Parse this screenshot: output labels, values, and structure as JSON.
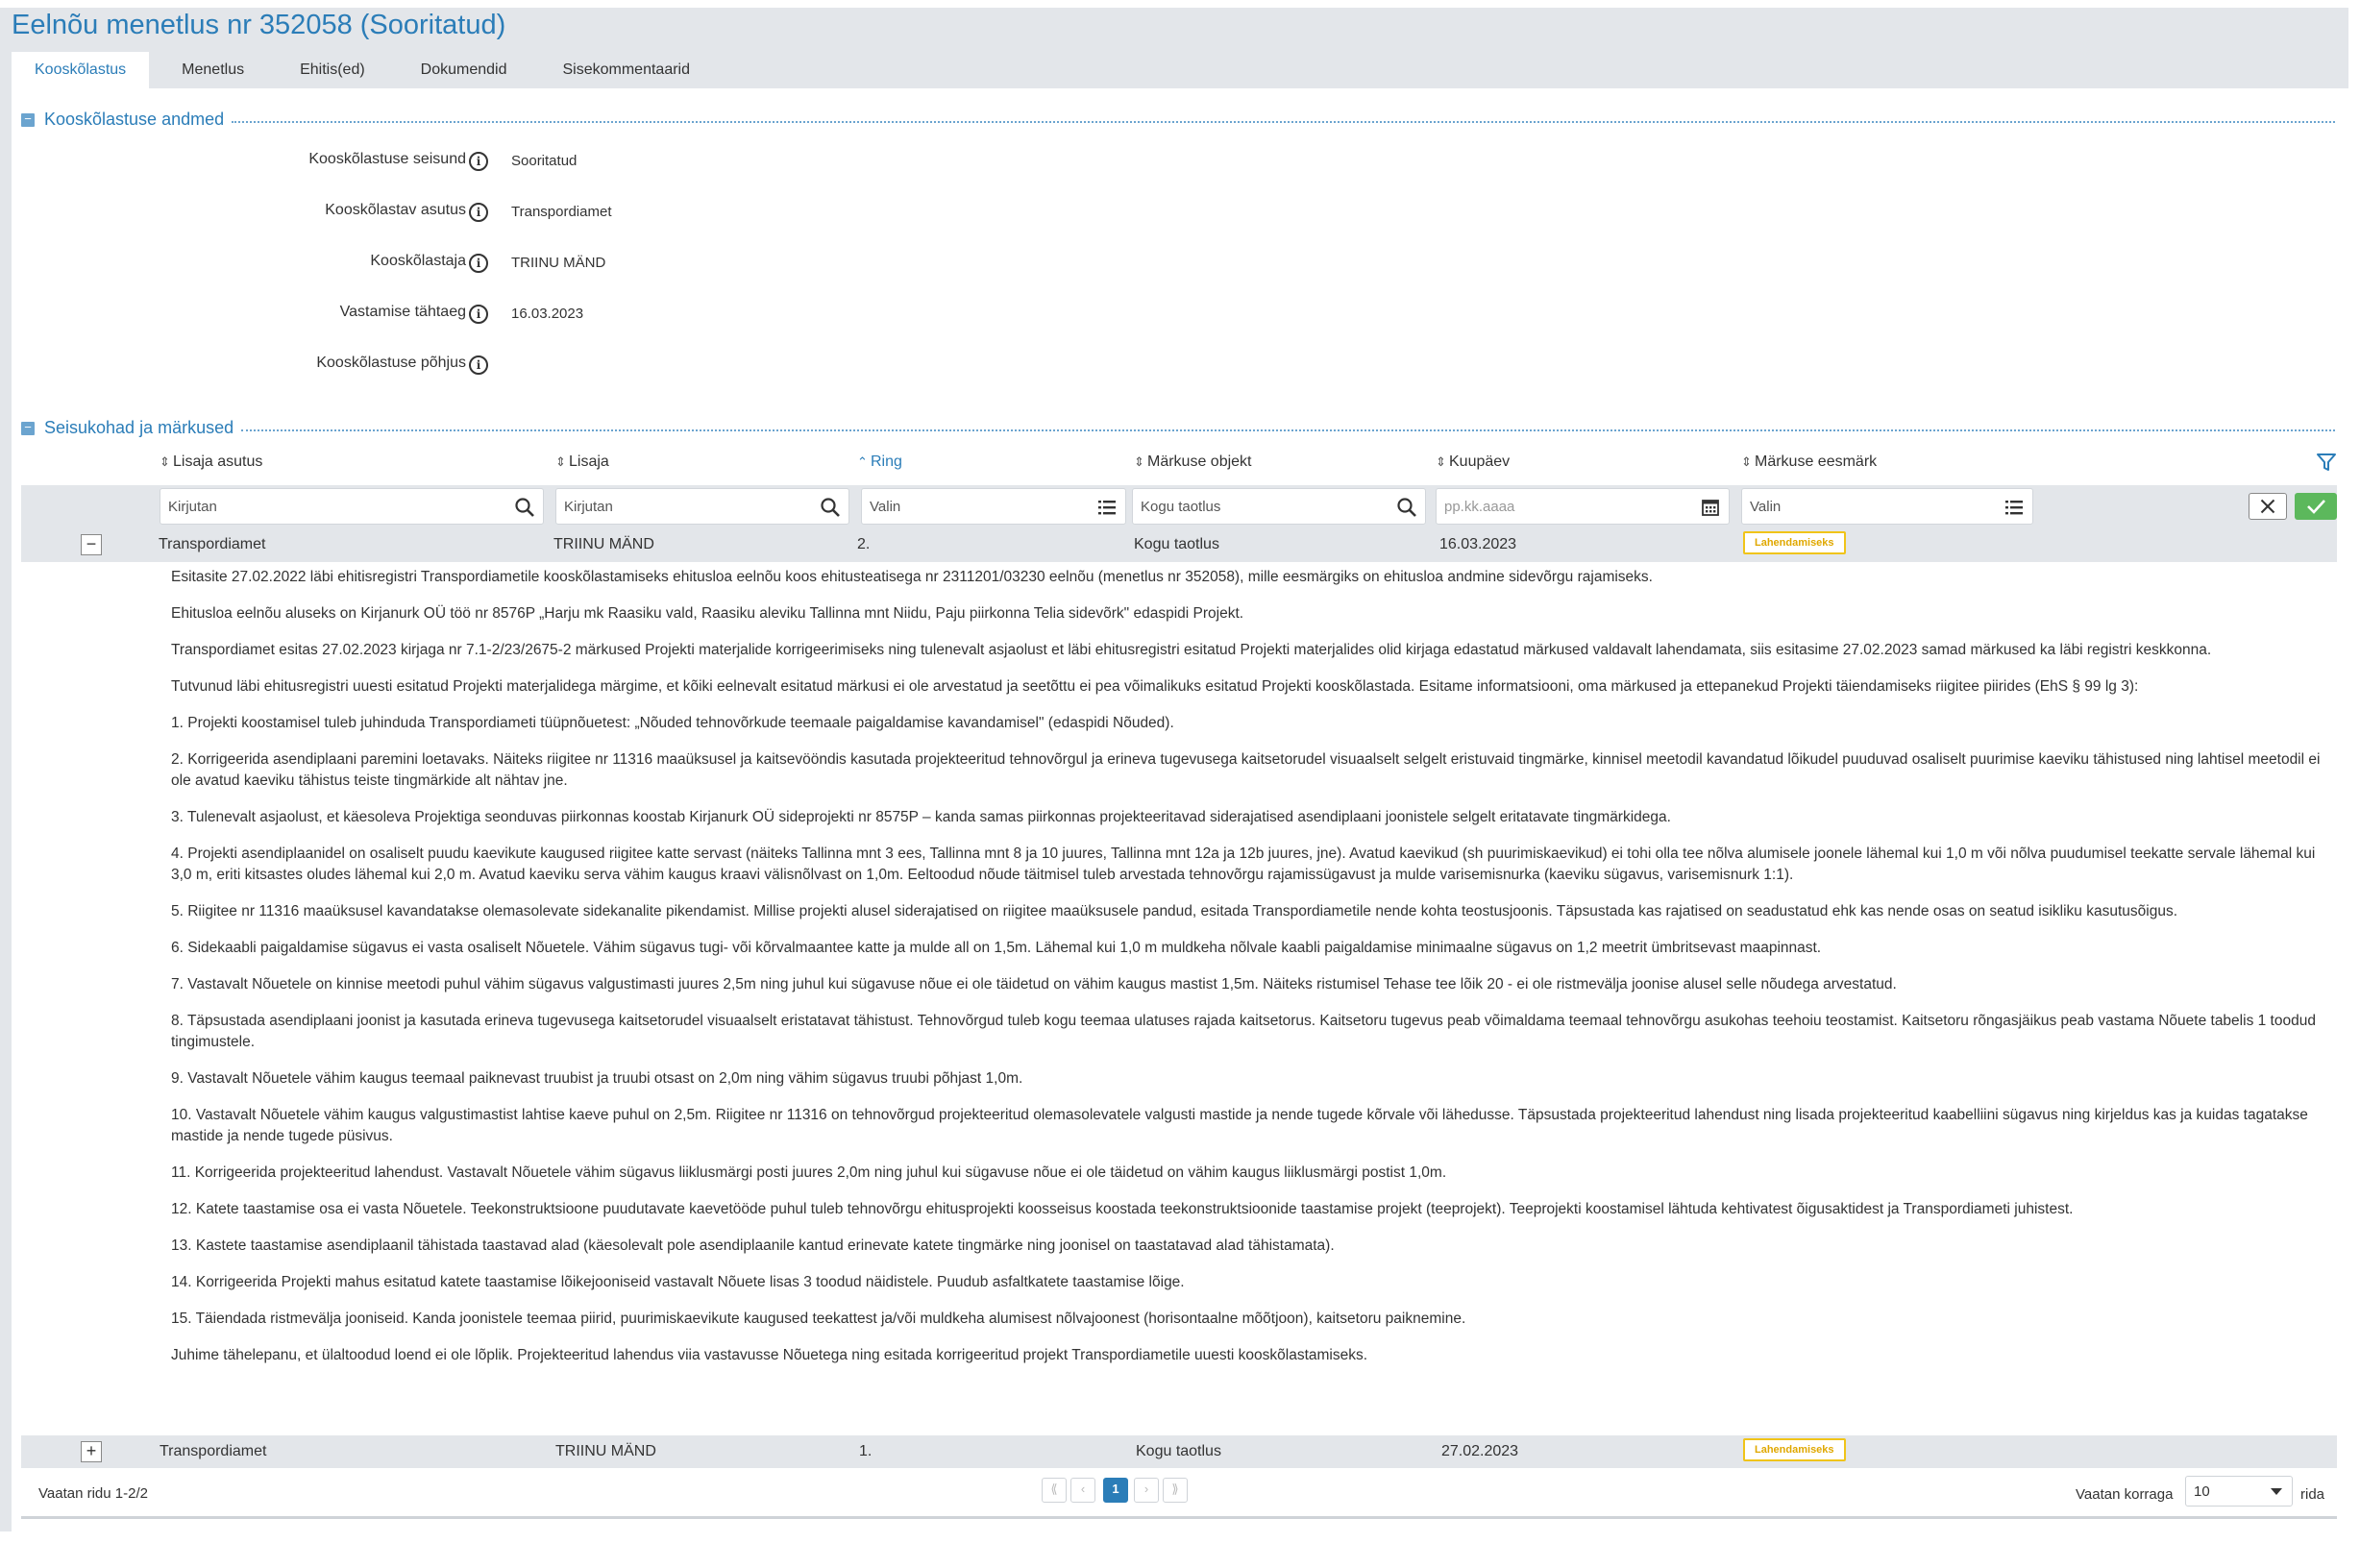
{
  "page": {
    "title": "Eelnõu menetlus nr 352058 (Sooritatud)"
  },
  "tabs": [
    {
      "label": "Kooskõlastus",
      "active": true
    },
    {
      "label": "Menetlus",
      "active": false
    },
    {
      "label": "Ehitis(ed)",
      "active": false
    },
    {
      "label": "Dokumendid",
      "active": false
    },
    {
      "label": "Sisekommentaarid",
      "active": false
    }
  ],
  "section1": {
    "title": "Kooskõlastuse andmed",
    "collapse_symbol": "−",
    "fields": [
      {
        "label": "Kooskõlastuse seisund",
        "value": "Sooritatud"
      },
      {
        "label": "Kooskõlastav asutus",
        "value": "Transpordiamet"
      },
      {
        "label": "Kooskõlastaja",
        "value": "TRIINU MÄND"
      },
      {
        "label": "Vastamise tähtaeg",
        "value": "16.03.2023"
      },
      {
        "label": "Kooskõlastuse põhjus",
        "value": ""
      }
    ],
    "info_symbol": "i"
  },
  "section2": {
    "title": "Seisukohad ja märkused",
    "collapse_symbol": "−"
  },
  "table": {
    "columns": [
      {
        "label": "Lisaja asutus",
        "sort": "both"
      },
      {
        "label": "Lisaja",
        "sort": "both"
      },
      {
        "label": "Ring",
        "sort": "asc"
      },
      {
        "label": "Märkuse objekt",
        "sort": "both"
      },
      {
        "label": "Kuupäev",
        "sort": "both"
      },
      {
        "label": "Märkuse eesmärk",
        "sort": "both"
      }
    ],
    "sort_both_symbol": "⇕",
    "sort_asc_symbol": "⌃",
    "filters": [
      {
        "text": "Kirjutan",
        "placeholder": false,
        "icon": "search-icon"
      },
      {
        "text": "Kirjutan",
        "placeholder": false,
        "icon": "search-icon"
      },
      {
        "text": "Valin",
        "placeholder": false,
        "icon": "list-icon"
      },
      {
        "text": "Kogu taotlus",
        "placeholder": false,
        "icon": "search-icon"
      },
      {
        "text": "pp.kk.aaaa",
        "placeholder": true,
        "icon": "calendar-icon"
      },
      {
        "text": "Valin",
        "placeholder": false,
        "icon": "list-icon"
      }
    ],
    "rows": [
      {
        "toggle": "−",
        "asutus": "Transpordiamet",
        "lisaja": "TRIINU MÄND",
        "ring": "2.",
        "objekt": "Kogu taotlus",
        "kuupaev": "16.03.2023",
        "eesmark": "Lahendamiseks",
        "expanded": true,
        "details": [
          "Esitasite 27.02.2022 läbi ehitisregistri Transpordiametile kooskõlastamiseks ehitusloa eelnõu koos ehitusteatisega nr 2311201/03230 eelnõu (menetlus nr 352058), mille eesmärgiks on ehitusloa andmine sidevõrgu rajamiseks.",
          "Ehitusloa eelnõu aluseks on Kirjanurk OÜ töö nr 8576P „Harju mk Raasiku vald, Raasiku aleviku Tallinna mnt Niidu, Paju piirkonna Telia sidevõrk\" edaspidi Projekt.",
          "Transpordiamet esitas 27.02.2023 kirjaga nr 7.1-2/23/2675-2 märkused Projekti materjalide korrigeerimiseks ning tulenevalt asjaolust et läbi ehitusregistri esitatud Projekti materjalides olid kirjaga edastatud märkused valdavalt lahendamata, siis esitasime 27.02.2023 samad märkused ka läbi registri keskkonna.",
          "Tutvunud läbi ehitusregistri uuesti esitatud Projekti materjalidega märgime, et kõiki eelnevalt esitatud märkusi ei ole arvestatud ja seetõttu ei pea võimalikuks esitatud Projekti kooskõlastada. Esitame informatsiooni, oma märkused ja ettepanekud Projekti täiendamiseks riigitee piirides (EhS § 99 lg 3):",
          "1. Projekti koostamisel tuleb juhinduda Transpordiameti tüüpnõuetest: „Nõuded tehnovõrkude teemaale paigaldamise kavandamisel\" (edaspidi Nõuded).",
          "2. Korrigeerida asendiplaani paremini loetavaks. Näiteks riigitee nr 11316 maaüksusel ja kaitsevööndis kasutada projekteeritud tehnovõrgul ja erineva tugevusega kaitsetorudel visuaalselt selgelt eristuvaid tingmärke, kinnisel meetodil kavandatud lõikudel puuduvad osaliselt puurimise kaeviku tähistused ning lahtisel meetodil ei ole avatud kaeviku tähistus teiste tingmärkide alt nähtav jne.",
          "3. Tulenevalt asjaolust, et käesoleva Projektiga seonduvas piirkonnas koostab Kirjanurk OÜ sideprojekti nr 8575P – kanda samas piirkonnas projekteeritavad siderajatised asendiplaani joonistele selgelt eritatavate tingmärkidega.",
          "4. Projekti asendiplaanidel on osaliselt puudu kaevikute kaugused riigitee katte servast (näiteks Tallinna mnt 3 ees, Tallinna mnt 8 ja 10 juures, Tallinna mnt 12a ja 12b juures, jne). Avatud kaevikud (sh puurimiskaevikud) ei tohi olla tee nõlva alumisele joonele lähemal kui 1,0 m või nõlva puudumisel teekatte servale lähemal kui 3,0 m, eriti kitsastes oludes lähemal kui 2,0 m. Avatud kaeviku serva vähim kaugus kraavi välisnõlvast on 1,0m. Eeltoodud nõude täitmisel tuleb arvestada tehnovõrgu rajamissügavust ja mulde varisemisnurka (kaeviku sügavus, varisemisnurk 1:1).",
          "5. Riigitee nr 11316 maaüksusel kavandatakse olemasolevate sidekanalite pikendamist. Millise projekti alusel siderajatised on riigitee maaüksusele pandud, esitada Transpordiametile nende kohta teostusjoonis. Täpsustada kas rajatised on seadustatud ehk kas nende osas on seatud isikliku kasutusõigus.",
          "6. Sidekaabli paigaldamise sügavus ei vasta osaliselt Nõuetele. Vähim sügavus tugi- või kõrvalmaantee katte ja mulde all on 1,5m. Lähemal kui 1,0 m muldkeha nõlvale kaabli paigaldamise minimaalne sügavus on 1,2 meetrit ümbritsevast maapinnast.",
          "7. Vastavalt Nõuetele on kinnise meetodi puhul vähim sügavus valgustimasti juures 2,5m ning juhul kui sügavuse nõue ei ole täidetud on vähim kaugus mastist 1,5m. Näiteks ristumisel Tehase tee lõik 20  - ei ole ristmevälja joonise alusel selle nõudega arvestatud.",
          "8. Täpsustada asendiplaani joonist ja kasutada erineva tugevusega kaitsetorudel visuaalselt eristatavat tähistust. Tehnovõrgud tuleb kogu teemaa ulatuses rajada kaitsetorus. Kaitsetoru tugevus peab võimaldama teemaal tehnovõrgu asukohas teehoiu teostamist. Kaitsetoru rõngasjäikus peab vastama Nõuete tabelis 1 toodud tingimustele.",
          "9. Vastavalt Nõuetele vähim kaugus teemaal paiknevast truubist ja truubi otsast on 2,0m ning vähim sügavus truubi põhjast 1,0m.",
          "10.  Vastavalt Nõuetele vähim kaugus valgustimastist lahtise kaeve puhul on 2,5m. Riigitee nr 11316 on tehnovõrgud projekteeritud olemasolevatele valgusti mastide ja nende tugede kõrvale või lähedusse. Täpsustada projekteeritud lahendust ning lisada projekteeritud kaabelliini sügavus ning kirjeldus kas ja kuidas tagatakse mastide ja nende tugede püsivus.",
          "11.  Korrigeerida projekteeritud lahendust. Vastavalt Nõuetele vähim sügavus liiklusmärgi posti juures 2,0m ning juhul kui sügavuse nõue ei ole täidetud on vähim kaugus liiklusmärgi postist 1,0m.",
          "12.  Katete taastamise osa ei vasta Nõuetele. Teekonstruktsioone puudutavate kaevetööde puhul tuleb tehnovõrgu ehitusprojekti koosseisus koostada teekonstruktsioonide taastamise projekt (teeprojekt). Teeprojekti koostamisel lähtuda kehtivatest õigusaktidest ja Transpordiameti juhistest.",
          "13.  Kastete taastamise asendiplaanil tähistada taastavad alad (käesolevalt pole asendiplaanile kantud erinevate katete tingmärke ning joonisel on taastatavad alad tähistamata).",
          "14.  Korrigeerida Projekti mahus esitatud katete taastamise lõikejooniseid vastavalt Nõuete lisas 3 toodud näidistele. Puudub asfaltkatete taastamise lõige.",
          "15.  Täiendada ristmevälja jooniseid. Kanda joonistele teemaa piirid, puurimiskaevikute kaugused teekattest ja/või muldkeha alumisest nõlvajoonest (horisontaalne mõõtjoon), kaitsetoru paiknemine.",
          "Juhime tähelepanu, et ülaltoodud loend ei ole lõplik. Projekteeritud lahendus viia vastavusse Nõuetega ning esitada korrigeeritud projekt Transpordiametile uuesti kooskõlastamiseks."
        ]
      },
      {
        "toggle": "+",
        "asutus": "Transpordiamet",
        "lisaja": "TRIINU MÄND",
        "ring": "1.",
        "objekt": "Kogu taotlus",
        "kuupaev": "27.02.2023",
        "eesmark": "Lahendamiseks",
        "expanded": false
      }
    ]
  },
  "footer": {
    "row_count": "Vaatan ridu 1-2/2",
    "pager": {
      "first": "⟪",
      "prev": "‹",
      "current": "1",
      "next": "›",
      "last": "⟫"
    },
    "per_page_label": "Vaatan korraga",
    "per_page_value": "10",
    "per_page_suffix": "rida"
  },
  "colors": {
    "accent": "#2b7db8",
    "band": "#e3e6ea",
    "badge_border": "#f0c419",
    "apply_green": "#5cb85c"
  }
}
